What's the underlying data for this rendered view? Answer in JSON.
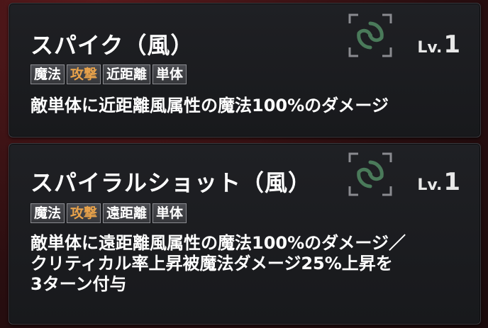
{
  "skills": [
    {
      "name": "スパイク（風）",
      "element_icon": "wind-element-icon",
      "level_prefix": "Lv.",
      "level": "1",
      "tags": [
        {
          "label": "魔法",
          "type": "normal"
        },
        {
          "label": "攻撃",
          "type": "attack"
        },
        {
          "label": "近距離",
          "type": "normal"
        },
        {
          "label": "単体",
          "type": "normal"
        }
      ],
      "description": "敵単体に近距離風属性の魔法100%のダメージ"
    },
    {
      "name": "スパイラルショット（風）",
      "element_icon": "wind-element-icon",
      "level_prefix": "Lv.",
      "level": "1",
      "tags": [
        {
          "label": "魔法",
          "type": "normal"
        },
        {
          "label": "攻撃",
          "type": "attack"
        },
        {
          "label": "遠距離",
          "type": "normal"
        },
        {
          "label": "単体",
          "type": "normal"
        }
      ],
      "description": "敵単体に遠距離風属性の魔法100%のダメージ／\nクリティカル率上昇被魔法ダメージ25%上昇を\n3ターン付与"
    }
  ],
  "colors": {
    "attack_tag": "#e8a24a",
    "wind_icon": "#4a7a5a",
    "card_bg": "#1c1d20"
  }
}
